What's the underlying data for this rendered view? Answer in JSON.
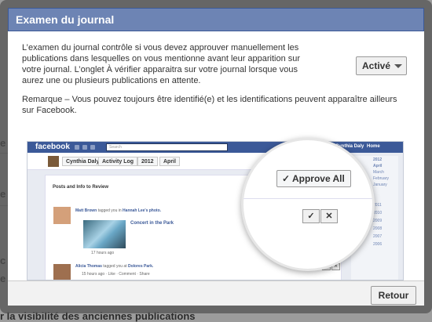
{
  "background_page": {
    "bottom_heading": "r la visibilité des anciennes publications",
    "left_fragments": [
      "e",
      "e",
      "c",
      "e"
    ]
  },
  "dialog": {
    "title": "Examen du journal",
    "description": "L’examen du journal contrôle si vous devez approuver manuellement les publications dans lesquelles on vous mentionne avant leur apparition sur votre journal. L’onglet À vérifier apparaitra sur votre journal lorsque vous aurez une ou plusieurs publications en attente.",
    "note": "Remarque – Vous pouvez toujours être identifié(e) et les identifications peuvent apparaître ailleurs sur Facebook.",
    "setting": {
      "selected": "Activé",
      "icon": "chevron-down-icon"
    },
    "return_label": "Retour"
  },
  "preview": {
    "logo": "facebook",
    "search_placeholder": "Search",
    "user": "Cynthia Daly",
    "home": "Home",
    "subbar": {
      "name": "Cynthia Daly",
      "activity_log": "Activity Log",
      "year": "2012",
      "month": "April"
    },
    "panel_title": "Posts and Info to Review",
    "post1": {
      "author": "Matt Brown",
      "text": "tagged you in",
      "target": "Hannah Lee's photo.",
      "link": "Concert in the Park",
      "time": "17 hours ago"
    },
    "post2": {
      "author": "Alicia Thomas",
      "text": "tagged you at",
      "target": "Dolores Park.",
      "time": "15 hours ago · Like · Comment · Share"
    },
    "timeline_years": [
      "2012",
      "April",
      "March",
      "February",
      "January",
      "2011",
      "2010",
      "2009",
      "2008",
      "2007",
      "2006"
    ],
    "approve_all": "Approve All",
    "approve_icon": "checkmark-icon",
    "remove_icon": "close-icon"
  }
}
